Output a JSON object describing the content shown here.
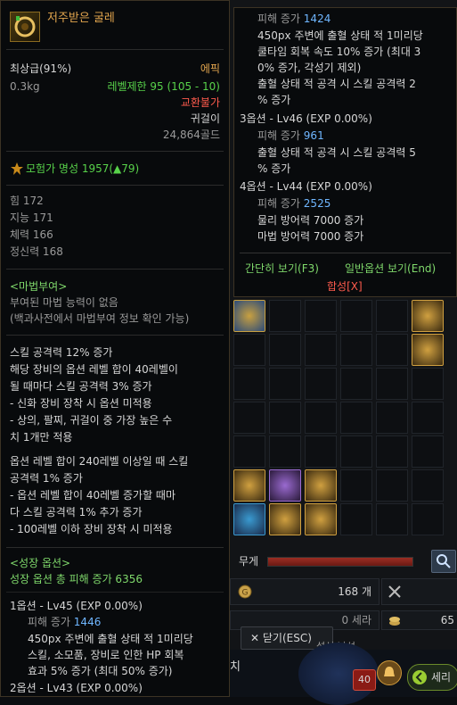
{
  "item": {
    "name": "저주받은 굴레",
    "grade": "최상급(91%)",
    "rarity": "에픽",
    "weight": "0.3kg",
    "level_req": "레벨제한 95 (105 - 10)",
    "trade": "교환불가",
    "type": "귀걸이",
    "price": "24,864골드",
    "fame": "모험가 명성 1957(▲79)",
    "stats": [
      "힘 172",
      "지능 171",
      "체력 166",
      "정신력 168"
    ],
    "enchant_header": "<마법부여>",
    "enchant_none": "부여된 마법 능력이 없음",
    "enchant_hint": "(백과사전에서 마법부여 정보 확인 가능)",
    "desc1": [
      "스킬 공격력 12% 증가",
      "해당 장비의 옵션 레벨 합이 40레벨이",
      "될 때마다 스킬 공격력 3% 증가",
      "- 신화 장비 장착 시 옵션 미적용",
      "- 상의, 팔찌, 귀걸이 중 가장 높은 수",
      "치 1개만 적용"
    ],
    "desc2": [
      "옵션 레벨 합이 240레벨 이상일 때 스킬",
      "공격력 1% 증가",
      "- 옵션 레벨 합이 40레벨 증가할 때마",
      "다 스킬 공격력 1% 추가 증가",
      "- 100레벨 이하 장비 장착 시 미적용"
    ],
    "growth_header": "<성장 옵션>",
    "growth_total": "성장 옵션 총 피해 증가 6356",
    "opt1_title": "1옵션 - Lv45 (EXP 0.00%)",
    "opt1_dmg": "피해 증가 1446",
    "opt1_lines": [
      "450px 주변에 출혈 상태 적 1미리당",
      "스킬, 소모품, 장비로 인한 HP 회복",
      "효과 5% 증가 (최대 50% 증가)"
    ],
    "opt2_title": "2옵션 - Lv43 (EXP 0.00%)"
  },
  "right": {
    "top_dmg": "피해 증가 1424",
    "top_lines": [
      "450px 주변에 출혈 상태 적 1미리당",
      "쿨타임 회복 속도 10% 증가 (최대 3",
      "0% 증가, 각성기 제외)",
      "출혈 상태 적 공격 시 스킬 공격력 2",
      "% 증가"
    ],
    "opt3_title": "3옵션 - Lv46 (EXP 0.00%)",
    "opt3_dmg": "피해 증가 961",
    "opt3_lines": [
      "출혈 상태 적 공격 시 스킬 공격력 5",
      "% 증가"
    ],
    "opt4_title": "4옵션 - Lv44 (EXP 0.00%)",
    "opt4_dmg": "피해 증가 2525",
    "opt4_lines": [
      "물리 방어력 7000 증가",
      "마법 방어력 7000 증가"
    ],
    "view_simple": "간단히 보기(F3)",
    "view_normal": "일반옵션 보기(End)",
    "combine": "합성[X]"
  },
  "inventory": {
    "weight_label": "무게",
    "gold_count": "168 개",
    "cera": "0 세라",
    "right_num": "65",
    "close": "✕ 닫기(ESC)",
    "sub": "섭석 날성",
    "left_frag": "치",
    "badge": "40",
    "cera_btn": "세리"
  },
  "colors": {
    "gold": "#e2a54e",
    "green": "#58d24a",
    "blue": "#6fb6ff",
    "red": "#ff5b4d"
  }
}
